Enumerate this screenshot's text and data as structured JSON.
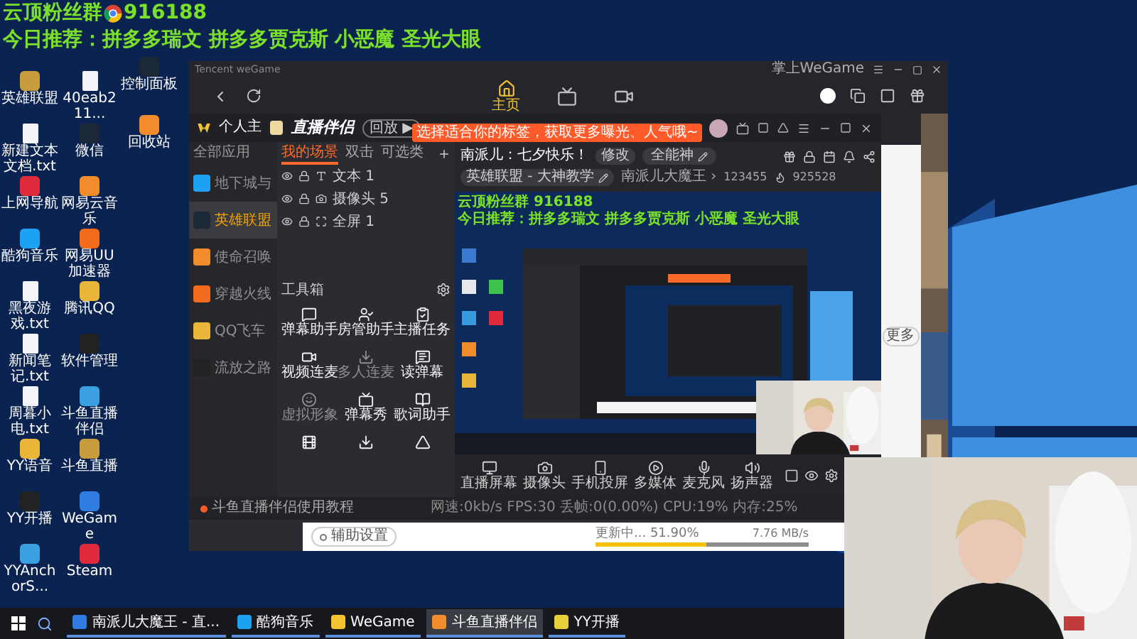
{
  "overlay": {
    "group_label": "云顶粉丝群",
    "group_number": "916188",
    "recommend": "今日推荐：拼多多瑞文 拼多多贾克斯 小恶魔 圣光大眼"
  },
  "desktop_columns": [
    [
      {
        "label": "英雄联盟",
        "kind": "app"
      },
      {
        "label": "新建文本文档.txt",
        "kind": "file"
      },
      {
        "label": "上网导航",
        "kind": "app"
      },
      {
        "label": "酷狗音乐",
        "kind": "app"
      },
      {
        "label": "黑夜游戏.txt",
        "kind": "file"
      },
      {
        "label": "新闻笔记.txt",
        "kind": "file"
      },
      {
        "label": "周暮小电.txt",
        "kind": "file"
      },
      {
        "label": "YY语音",
        "kind": "app"
      },
      {
        "label": "YY开播",
        "kind": "app"
      },
      {
        "label": "YYAnchorS...",
        "kind": "app"
      }
    ],
    [
      {
        "label": "40eab211...",
        "kind": "file"
      },
      {
        "label": "微信",
        "kind": "app"
      },
      {
        "label": "网易云音乐",
        "kind": "app"
      },
      {
        "label": "网易UU加速器",
        "kind": "app"
      },
      {
        "label": "腾讯QQ",
        "kind": "app"
      },
      {
        "label": "软件管理",
        "kind": "app"
      },
      {
        "label": "斗鱼直播伴侣",
        "kind": "app"
      },
      {
        "label": "斗鱼直播",
        "kind": "app"
      },
      {
        "label": "WeGame",
        "kind": "app"
      },
      {
        "label": "Steam",
        "kind": "app"
      }
    ],
    [
      {
        "label": "控制面板",
        "kind": "app"
      },
      {
        "label": "回收站",
        "kind": "app"
      }
    ]
  ],
  "wegame": {
    "title": "Tencent weGame",
    "mobile_label": "掌上WeGame",
    "nav": [
      {
        "label": "主页",
        "selected": true
      },
      {
        "selected": false
      },
      {
        "selected": false
      }
    ],
    "more_button": "更多",
    "update": {
      "settings_button": "辅助设置",
      "status": "更新中... 51.90%",
      "speed": "7.76 MB/s",
      "level": 0.52
    }
  },
  "streamer": {
    "home_label": "个人主",
    "app_name": "直播伴侣",
    "replay_button": "回放 ▶",
    "tooltip": "选择适合你的标签，获取更多曝光、人气哦~",
    "sidebar": {
      "header": "全部应用",
      "items": [
        {
          "label": "地下城与",
          "selected": false
        },
        {
          "label": "英雄联盟",
          "selected": true
        },
        {
          "label": "使命召唤",
          "selected": false
        },
        {
          "label": "穿越火线",
          "selected": false
        },
        {
          "label": "QQ飞车",
          "selected": false
        },
        {
          "label": "流放之路",
          "selected": false
        }
      ]
    },
    "scene_tabs": [
      {
        "label": "我的场景",
        "selected": true
      },
      {
        "label": "双击",
        "selected": false
      },
      {
        "label": "可选类",
        "selected": false
      }
    ],
    "sources": [
      {
        "label": "文本 1"
      },
      {
        "label": "摄像头 5"
      },
      {
        "label": "全屏 1"
      }
    ],
    "toolbox_title": "工具箱",
    "tools": [
      {
        "label": "弹幕助手",
        "disabled": false
      },
      {
        "label": "房管助手",
        "disabled": false
      },
      {
        "label": "主播任务",
        "disabled": false
      },
      {
        "label": "视频连麦",
        "disabled": false
      },
      {
        "label": "多人连麦",
        "disabled": true
      },
      {
        "label": "读弹幕",
        "disabled": false
      },
      {
        "label": "虚拟形象",
        "disabled": true
      },
      {
        "label": "弹幕秀",
        "disabled": false
      },
      {
        "label": "歌词助手",
        "disabled": false
      },
      {
        "disabled": false
      },
      {
        "disabled": false
      },
      {
        "disabled": false
      }
    ],
    "room": {
      "title": "南派儿：七夕快乐！",
      "edit_button": "修改",
      "tag": "全能神",
      "category": "英雄联盟 - 大神教学",
      "streamer_name": "南派儿大魔王 ›",
      "room_id": "123455",
      "popularity": "925528"
    },
    "preview": {
      "group_line": "云顶粉丝群 916188",
      "recommend_line": "今日推荐：拼多多瑞文 拼多多贾克斯 小恶魔 圣光大眼"
    },
    "controls": [
      {
        "label": "直播屏幕"
      },
      {
        "label": "摄像头"
      },
      {
        "label": "手机投屏"
      },
      {
        "label": "多媒体"
      },
      {
        "label": "麦克风"
      },
      {
        "label": "扬声器"
      }
    ],
    "tutorial_link": "斗鱼直播伴侣使用教程",
    "stats": "网速:0kb/s FPS:30 丢帧:0(0.00%) CPU:19% 内存:25%"
  },
  "taskbar": {
    "items": [
      {
        "label": "南派儿大魔王 - 直...",
        "selected": false
      },
      {
        "label": "酷狗音乐",
        "selected": false
      },
      {
        "label": "WeGame",
        "selected": false
      },
      {
        "label": "斗鱼直播伴侣",
        "selected": true
      },
      {
        "label": "YY开播",
        "selected": false
      }
    ]
  }
}
